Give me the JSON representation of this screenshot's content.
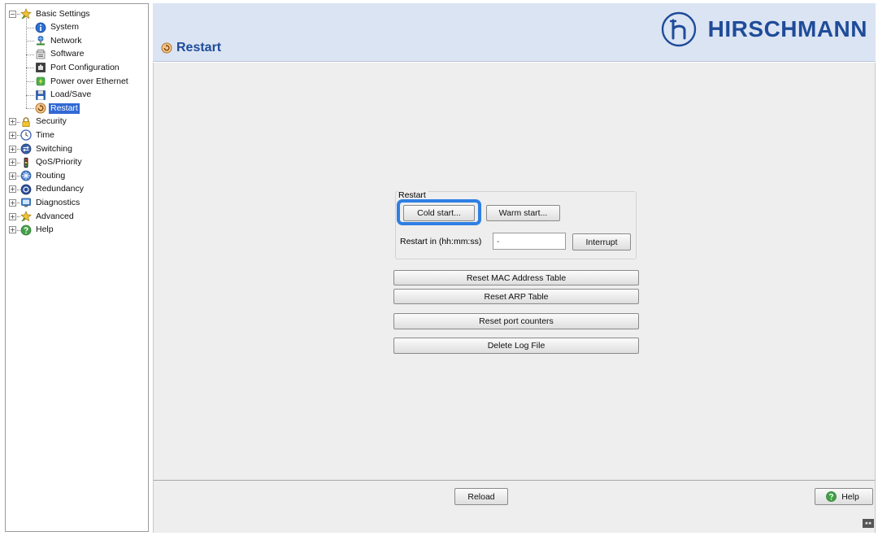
{
  "sidebar": {
    "items": [
      {
        "label": "Basic Settings",
        "icon": "star-icon",
        "level": 0,
        "expander": "minus"
      },
      {
        "label": "System",
        "icon": "info-icon",
        "level": 1
      },
      {
        "label": "Network",
        "icon": "network-icon",
        "level": 1
      },
      {
        "label": "Software",
        "icon": "software-icon",
        "level": 1
      },
      {
        "label": "Port Configuration",
        "icon": "port-icon",
        "level": 1
      },
      {
        "label": "Power over Ethernet",
        "icon": "poe-icon",
        "level": 1
      },
      {
        "label": "Load/Save",
        "icon": "floppy-icon",
        "level": 1
      },
      {
        "label": "Restart",
        "icon": "restart-icon",
        "level": 1,
        "selected": true
      },
      {
        "label": "Security",
        "icon": "lock-icon",
        "level": 0,
        "expander": "plus"
      },
      {
        "label": "Time",
        "icon": "clock-icon",
        "level": 0,
        "expander": "plus"
      },
      {
        "label": "Switching",
        "icon": "switching-icon",
        "level": 0,
        "expander": "plus"
      },
      {
        "label": "QoS/Priority",
        "icon": "traffic-light-icon",
        "level": 0,
        "expander": "plus"
      },
      {
        "label": "Routing",
        "icon": "routing-icon",
        "level": 0,
        "expander": "plus"
      },
      {
        "label": "Redundancy",
        "icon": "redundancy-icon",
        "level": 0,
        "expander": "plus"
      },
      {
        "label": "Diagnostics",
        "icon": "diagnostics-icon",
        "level": 0,
        "expander": "plus"
      },
      {
        "label": "Advanced",
        "icon": "star-icon",
        "level": 0,
        "expander": "plus"
      },
      {
        "label": "Help",
        "icon": "help-icon",
        "level": 0,
        "expander": "plus"
      }
    ]
  },
  "header": {
    "title": "Restart",
    "title_icon": "restart-icon",
    "brand": "HIRSCHMANN",
    "brand_color": "#1f4c99"
  },
  "restart_group": {
    "legend": "Restart",
    "cold_start": "Cold start...",
    "warm_start": "Warm start...",
    "restart_in_label": "Restart in (hh:mm:ss)",
    "restart_in_value": "-",
    "interrupt": "Interrupt",
    "highlight_color": "#2f7fe3"
  },
  "actions": {
    "reset_mac": "Reset MAC Address Table",
    "reset_arp": "Reset ARP Table",
    "reset_port_counters": "Reset port counters",
    "delete_log": "Delete Log File"
  },
  "footer": {
    "reload": "Reload",
    "help": "Help"
  },
  "colors": {
    "header_bg": "#dbe4f3",
    "panel_bg": "#eeeeee",
    "selection": "#3168d5"
  }
}
